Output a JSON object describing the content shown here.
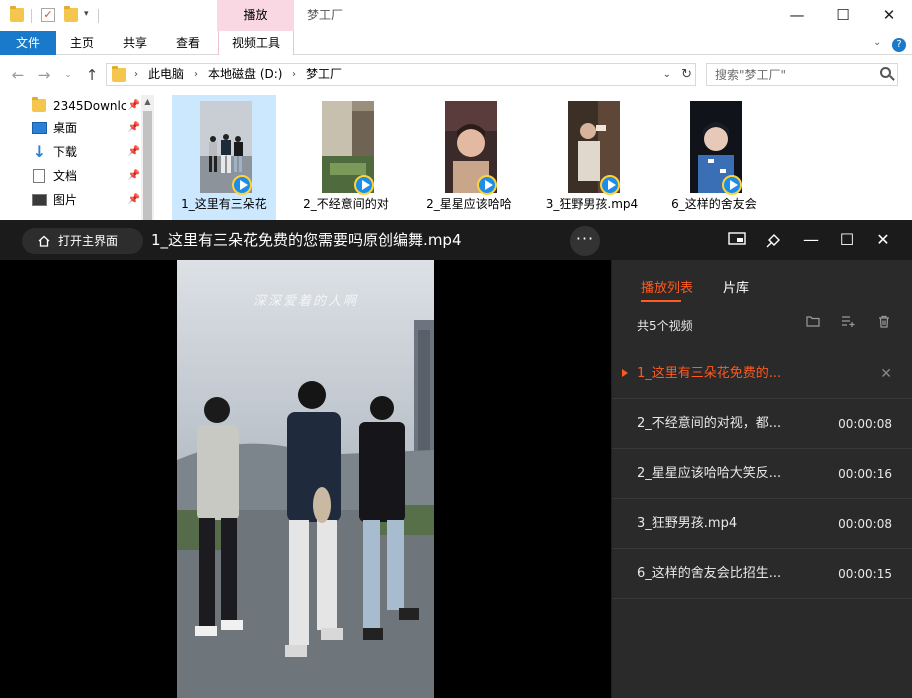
{
  "explorer": {
    "title": "梦工厂",
    "context_tab": "播放",
    "ribbon_tabs": [
      "文件",
      "主页",
      "共享",
      "查看",
      "视频工具"
    ],
    "breadcrumb": [
      "此电脑",
      "本地磁盘 (D:)",
      "梦工厂"
    ],
    "search_placeholder": "搜索\"梦工厂\"",
    "sidebar": [
      {
        "label": "2345Downlc",
        "icon": "folder-icon"
      },
      {
        "label": "桌面",
        "icon": "desktop-icon"
      },
      {
        "label": "下载",
        "icon": "download-icon"
      },
      {
        "label": "文档",
        "icon": "document-icon"
      },
      {
        "label": "图片",
        "icon": "picture-icon"
      }
    ],
    "files": [
      {
        "name": "1_这里有三朵花",
        "selected": true
      },
      {
        "name": "2_不经意间的对",
        "selected": false
      },
      {
        "name": "2_星星应该哈哈",
        "selected": false
      },
      {
        "name": "3_狂野男孩.mp4",
        "selected": false
      },
      {
        "name": "6_这样的舍友会",
        "selected": false
      }
    ]
  },
  "player": {
    "home_label": "打开主界面",
    "title": "1_这里有三朵花免费的您需要吗原创编舞.mp4",
    "more_label": "···",
    "video_caption": "深深爱着的人啊",
    "tabs": {
      "playlist": "播放列表",
      "library": "片库"
    },
    "count_label": "共5个视频",
    "playlist": [
      {
        "name": "1_这里有三朵花免费的...",
        "duration": "",
        "playing": true
      },
      {
        "name": "2_不经意间的对视，都...",
        "duration": "00:00:08",
        "playing": false
      },
      {
        "name": "2_星星应该哈哈大笑反...",
        "duration": "00:00:16",
        "playing": false
      },
      {
        "name": "3_狂野男孩.mp4",
        "duration": "00:00:08",
        "playing": false
      },
      {
        "name": "6_这样的舍友会比招生...",
        "duration": "00:00:15",
        "playing": false
      }
    ]
  },
  "colors": {
    "accent_orange": "#ff5a1f",
    "explorer_blue": "#1979ca",
    "context_pink": "#f9d8e4",
    "player_bg": "#1b1b1b"
  }
}
